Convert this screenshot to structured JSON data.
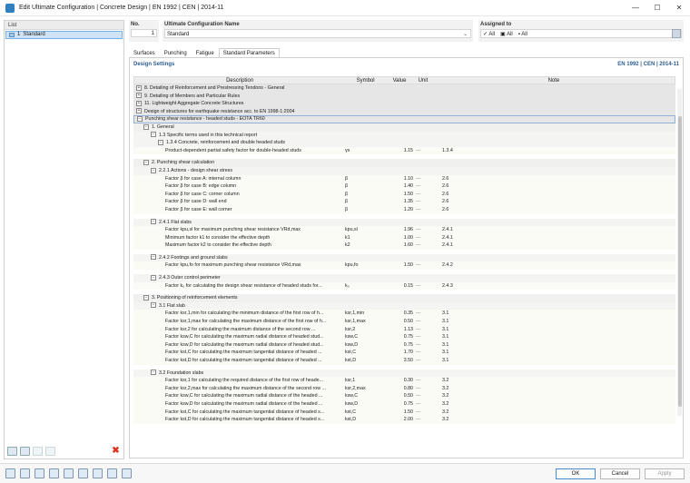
{
  "window": {
    "title": "Edit Ultimate Configuration | Concrete Design | EN 1992 | CEN | 2014-11",
    "minimize": "—",
    "maximize": "☐",
    "close": "✕"
  },
  "list": {
    "header": "List",
    "items": [
      {
        "number": "1",
        "label": "Standard"
      }
    ]
  },
  "no": {
    "label": "No.",
    "value": "1"
  },
  "name": {
    "label": "Ultimate Configuration Name",
    "value": "Standard",
    "dropdown": "⌄"
  },
  "assigned": {
    "label": "Assigned to",
    "items": [
      "All",
      "All",
      "All"
    ]
  },
  "tabs": [
    "Surfaces",
    "Punching",
    "Fatigue",
    "Standard Parameters"
  ],
  "settings": {
    "title": "Design Settings",
    "standard": "EN 1992 | CEN | 2014-11"
  },
  "columns": {
    "description": "Description",
    "symbol": "Symbol",
    "value": "Value",
    "unit": "Unit",
    "note": "Note"
  },
  "rows": [
    {
      "type": "top",
      "toggle": "+",
      "indent": 0,
      "desc": "8. Detailing of Reinforcement and Prestressing Tendons - General"
    },
    {
      "type": "top",
      "toggle": "+",
      "indent": 0,
      "desc": "9. Detailing of Members and Particular Rules"
    },
    {
      "type": "top",
      "toggle": "+",
      "indent": 0,
      "desc": "11. Lightweight Aggregate Concrete Structures"
    },
    {
      "type": "top",
      "toggle": "+",
      "indent": 0,
      "desc": "Design of structures for earthquake resistance acc. to EN 1998-1:2004"
    },
    {
      "type": "top",
      "toggle": "−",
      "indent": 0,
      "desc": "Punching shear resistance - headed studs - EOTA TR60",
      "highlight": true
    },
    {
      "type": "sec",
      "toggle": "−",
      "indent": 1,
      "desc": "1. General"
    },
    {
      "type": "sub",
      "toggle": "−",
      "indent": 2,
      "desc": "1.3 Specific terms used in this technical report"
    },
    {
      "type": "sub",
      "toggle": "−",
      "indent": 3,
      "desc": "1.3.4 Concrete, reinforcement and double headed studs"
    },
    {
      "type": "param",
      "indent": 4,
      "desc": "Product-dependent partial safety factor for double-headed studs",
      "sym": "γs",
      "val": "1.15",
      "unit": "---",
      "note": "1.3.4"
    },
    {
      "type": "blank"
    },
    {
      "type": "sec",
      "toggle": "−",
      "indent": 1,
      "desc": "2. Punching shear calculation"
    },
    {
      "type": "sub",
      "toggle": "−",
      "indent": 2,
      "desc": "2.2.1 Actions - design shear stress"
    },
    {
      "type": "param",
      "indent": 4,
      "desc": "Factor β for case A: internal column",
      "sym": "β",
      "val": "1.10",
      "unit": "---",
      "note": "2.6"
    },
    {
      "type": "param",
      "indent": 4,
      "desc": "Factor β for case B: edge column",
      "sym": "β",
      "val": "1.40",
      "unit": "---",
      "note": "2.6"
    },
    {
      "type": "param",
      "indent": 4,
      "desc": "Factor β for case C: corner column",
      "sym": "β",
      "val": "1.50",
      "unit": "---",
      "note": "2.6"
    },
    {
      "type": "param",
      "indent": 4,
      "desc": "Factor β for case D: wall end",
      "sym": "β",
      "val": "1.35",
      "unit": "---",
      "note": "2.6"
    },
    {
      "type": "param",
      "indent": 4,
      "desc": "Factor β for case E: wall corner",
      "sym": "β",
      "val": "1.20",
      "unit": "---",
      "note": "2.6"
    },
    {
      "type": "blank"
    },
    {
      "type": "sub",
      "toggle": "−",
      "indent": 2,
      "desc": "2.4.1 Flat slabs"
    },
    {
      "type": "param",
      "indent": 4,
      "desc": "Factor kpu,sl for maximum punching shear resistance VRd,max",
      "sym": "kpu,sl",
      "val": "1.96",
      "unit": "---",
      "note": "2.4.1"
    },
    {
      "type": "param",
      "indent": 4,
      "desc": "Minimum factor k1 to consider the effective depth",
      "sym": "k1",
      "val": "1.00",
      "unit": "---",
      "note": "2.4.1"
    },
    {
      "type": "param",
      "indent": 4,
      "desc": "Maximum factor k2 to consider the effective depth",
      "sym": "k2",
      "val": "1.60",
      "unit": "---",
      "note": "2.4.1"
    },
    {
      "type": "blank"
    },
    {
      "type": "sub",
      "toggle": "−",
      "indent": 2,
      "desc": "2.4.2 Footings and ground slabs"
    },
    {
      "type": "param",
      "indent": 4,
      "desc": "Factor kpu,fo for maximum punching shear resistance VRd,max",
      "sym": "kpu,fo",
      "val": "1.50",
      "unit": "---",
      "note": "2.4.2"
    },
    {
      "type": "blank"
    },
    {
      "type": "sub",
      "toggle": "−",
      "indent": 2,
      "desc": "2.4.3 Outer control perimeter"
    },
    {
      "type": "param",
      "indent": 4,
      "desc": "Factor k₀ for calculating the design shear resistance of headed studs for...",
      "sym": "k₀",
      "val": "0.15",
      "unit": "---",
      "note": "2.4.3"
    },
    {
      "type": "blank"
    },
    {
      "type": "sec",
      "toggle": "−",
      "indent": 1,
      "desc": "3. Positioning of reinforcement elements"
    },
    {
      "type": "sub",
      "toggle": "−",
      "indent": 2,
      "desc": "3.1 Flat slab"
    },
    {
      "type": "param",
      "indent": 4,
      "desc": "Factor ksr,1,min for calculating the minimum distance of the first row of h...",
      "sym": "ksr,1,min",
      "val": "0.35",
      "unit": "---",
      "note": "3.1"
    },
    {
      "type": "param",
      "indent": 4,
      "desc": "Factor ksr,1,max for calculating the maximum distance of the first row of h...",
      "sym": "ksr,1,max",
      "val": "0.50",
      "unit": "---",
      "note": "3.1"
    },
    {
      "type": "param",
      "indent": 4,
      "desc": "Factor ksr,2 for calculating the maximum distance of the second row ...",
      "sym": "ksr,2",
      "val": "1.13",
      "unit": "---",
      "note": "3.1"
    },
    {
      "type": "param",
      "indent": 4,
      "desc": "Factor ksw,C for calculating the maximum radial distance of headed stud...",
      "sym": "ksw,C",
      "val": "0.75",
      "unit": "---",
      "note": "3.1"
    },
    {
      "type": "param",
      "indent": 4,
      "desc": "Factor ksw,D for calculating the maximum radial distance of headed stud...",
      "sym": "ksw,D",
      "val": "0.75",
      "unit": "---",
      "note": "3.1"
    },
    {
      "type": "param",
      "indent": 4,
      "desc": "Factor kst,C for calculating the maximum tangential distance of headed ...",
      "sym": "kst,C",
      "val": "1.70",
      "unit": "---",
      "note": "3.1"
    },
    {
      "type": "param",
      "indent": 4,
      "desc": "Factor kst,D for calculating the maximum tangential distance of headed ...",
      "sym": "kst,D",
      "val": "3.50",
      "unit": "---",
      "note": "3.1"
    },
    {
      "type": "blank"
    },
    {
      "type": "sub",
      "toggle": "−",
      "indent": 2,
      "desc": "3.2 Foundation slabs"
    },
    {
      "type": "param",
      "indent": 4,
      "desc": "Factor ksr,1 for calculating the required distance of the first row of heade...",
      "sym": "ksr,1",
      "val": "0.30",
      "unit": "---",
      "note": "3.2"
    },
    {
      "type": "param",
      "indent": 4,
      "desc": "Factor ksr,2,max for calculating the maximum distance of the second row ...",
      "sym": "ksr,2,max",
      "val": "0.80",
      "unit": "---",
      "note": "3.2"
    },
    {
      "type": "param",
      "indent": 4,
      "desc": "Factor ksw,C for calculating the maximum radial distance of the headed ...",
      "sym": "ksw,C",
      "val": "0.50",
      "unit": "---",
      "note": "3.2"
    },
    {
      "type": "param",
      "indent": 4,
      "desc": "Factor ksw,D for calculating the maximum radial distance of the headed ...",
      "sym": "ksw,D",
      "val": "0.75",
      "unit": "---",
      "note": "3.2"
    },
    {
      "type": "param",
      "indent": 4,
      "desc": "Factor kst,C for calculating the maximum tangential distance of headed s...",
      "sym": "kst,C",
      "val": "1.50",
      "unit": "---",
      "note": "3.2"
    },
    {
      "type": "param",
      "indent": 4,
      "desc": "Factor kst,D for calculating the maximum tangential distance of headed s...",
      "sym": "kst,D",
      "val": "2.00",
      "unit": "---",
      "note": "3.2"
    }
  ],
  "buttons": {
    "ok": "OK",
    "cancel": "Cancel",
    "apply": "Apply"
  },
  "colors": {
    "accent": "#2e5e8e",
    "selection": "#cfe3f7",
    "delete": "#d32f2f"
  }
}
